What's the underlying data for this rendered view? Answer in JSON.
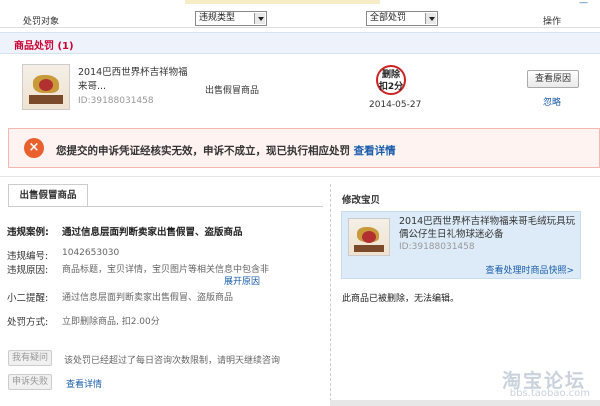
{
  "header": {
    "col_object": "处罚对象",
    "select_type": "违规类型",
    "select_status": "全部处罚",
    "col_action": "操作"
  },
  "section": {
    "title": "商品处罚 (1)"
  },
  "item": {
    "name": "2014巴西世界杯吉祥物福来哥...",
    "id": "ID:39188031458",
    "reason": "出售假冒商品",
    "stamp": "删除\n扣2分",
    "date": "2014-05-27",
    "view_reason": "查看原因",
    "ignore": "忽略"
  },
  "alert": {
    "icon": "×",
    "text": "您提交的申诉凭证经核实无效，申诉不成立，现已执行相应处罚",
    "link": "查看详情"
  },
  "detail": {
    "tab": "出售假冒商品",
    "case_label": "违规案例:",
    "case_value": "通过信息层面判断卖家出售假冒、盗版商品",
    "id_label": "违规编号:",
    "id_value": "1042653030",
    "cause_label": "违规原因:",
    "cause_value": "商品标题，宝贝详情，宝贝图片等相关信息中包含非",
    "expand_link": "展开原因",
    "tip_label": "小二提醒:",
    "tip_value": "通过信息层面判断卖家出售假冒、盗版商品",
    "punish_label": "处罚方式:",
    "punish_value": "立即删除商品, 扣2.00分",
    "question_btn": "我有疑问",
    "question_note": "该处罚已经超过了每日咨询次数限制，请明天继续咨询",
    "appeal_btn": "申诉失败",
    "appeal_link": "查看详情"
  },
  "right": {
    "title": "修改宝贝",
    "name": "2014巴西世界杯吉祥物福来哥毛绒玩具玩偶公仔生日礼物球迷必备",
    "id": "ID:39188031458",
    "link": "查看处理时商品快照>",
    "note": "此商品已被删除，无法编辑。"
  },
  "watermark": {
    "main": "淘宝论坛",
    "sub": "bbs.taobao.com"
  },
  "colors": {
    "accent_red": "#cc0033",
    "link_blue": "#1a5dab",
    "alert_orange": "#e8602b"
  }
}
